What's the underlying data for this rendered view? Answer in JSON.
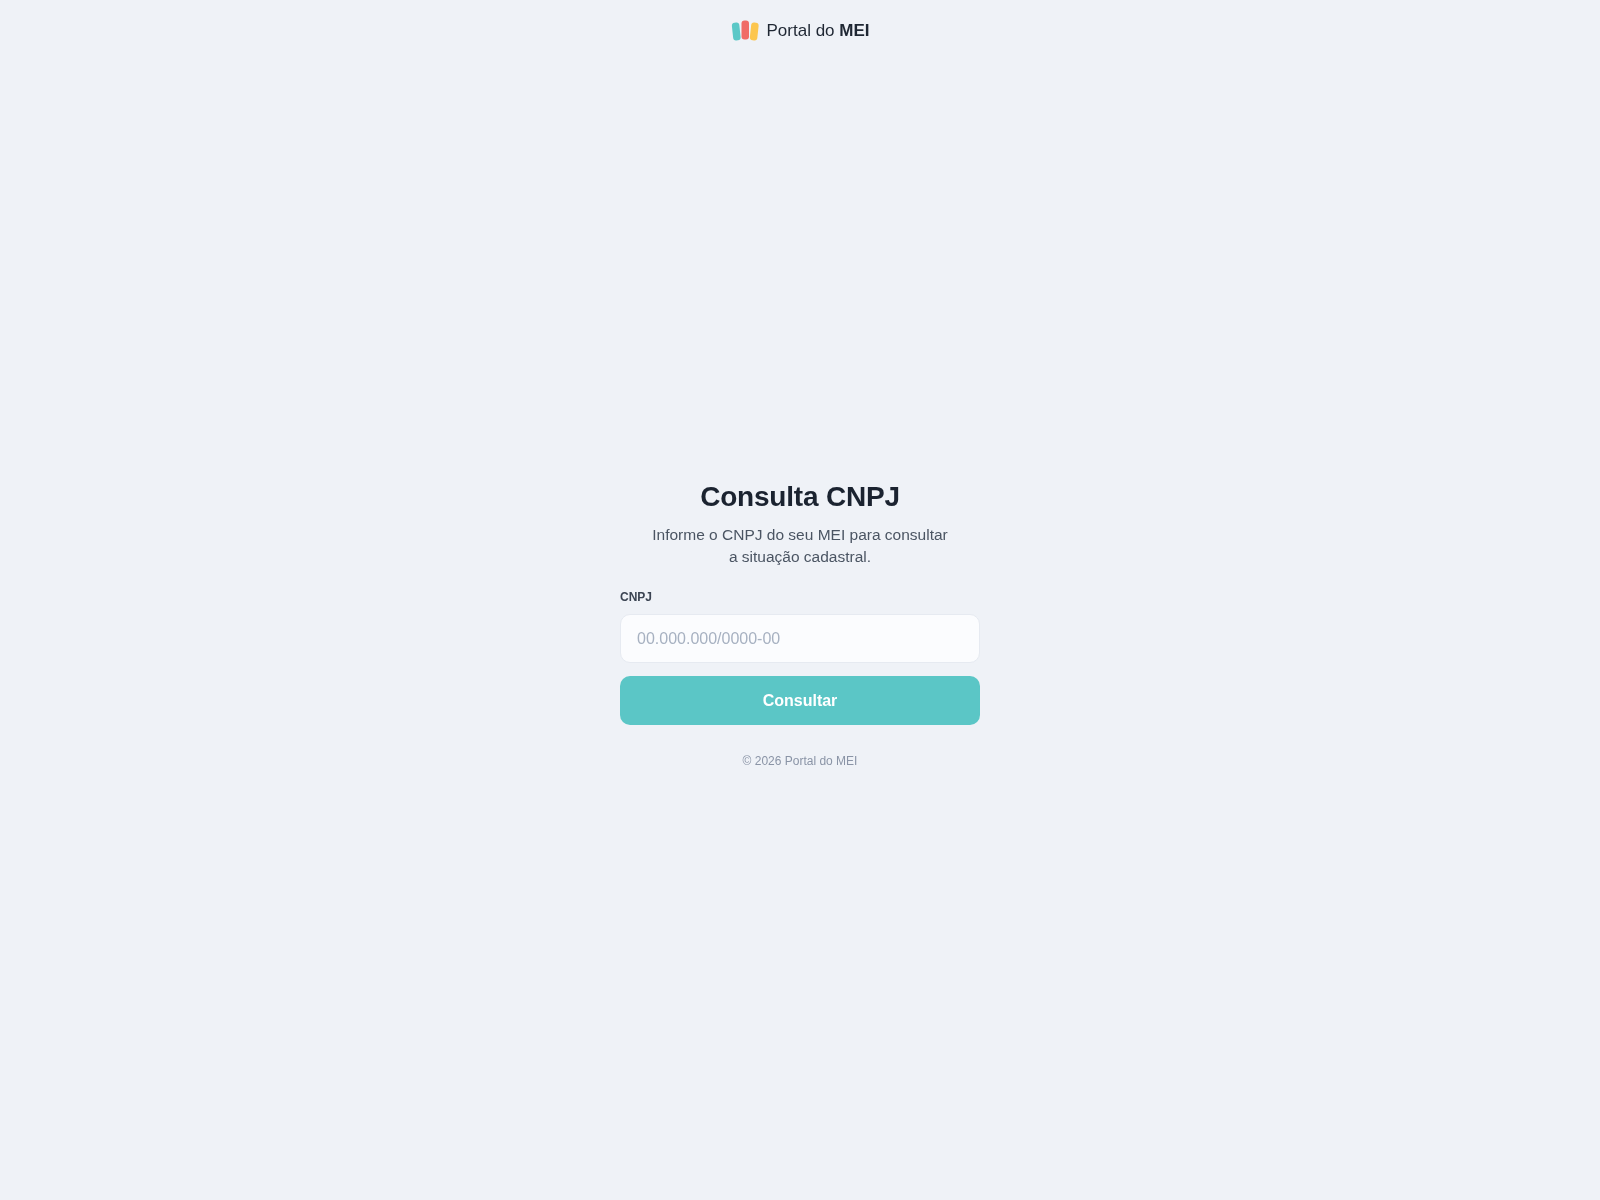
{
  "header": {
    "brand": "Portal do **MEI**"
  },
  "form": {
    "title": "Consulta CNPJ",
    "subtitle": "Informe o CNPJ do seu MEI para consultar a situação cadastral.",
    "field": {
      "label": "CNPJ",
      "placeholder": "00.000.000/0000-00"
    },
    "button": "Consultar"
  },
  "footer": "© 2026 Portal do MEI"
}
